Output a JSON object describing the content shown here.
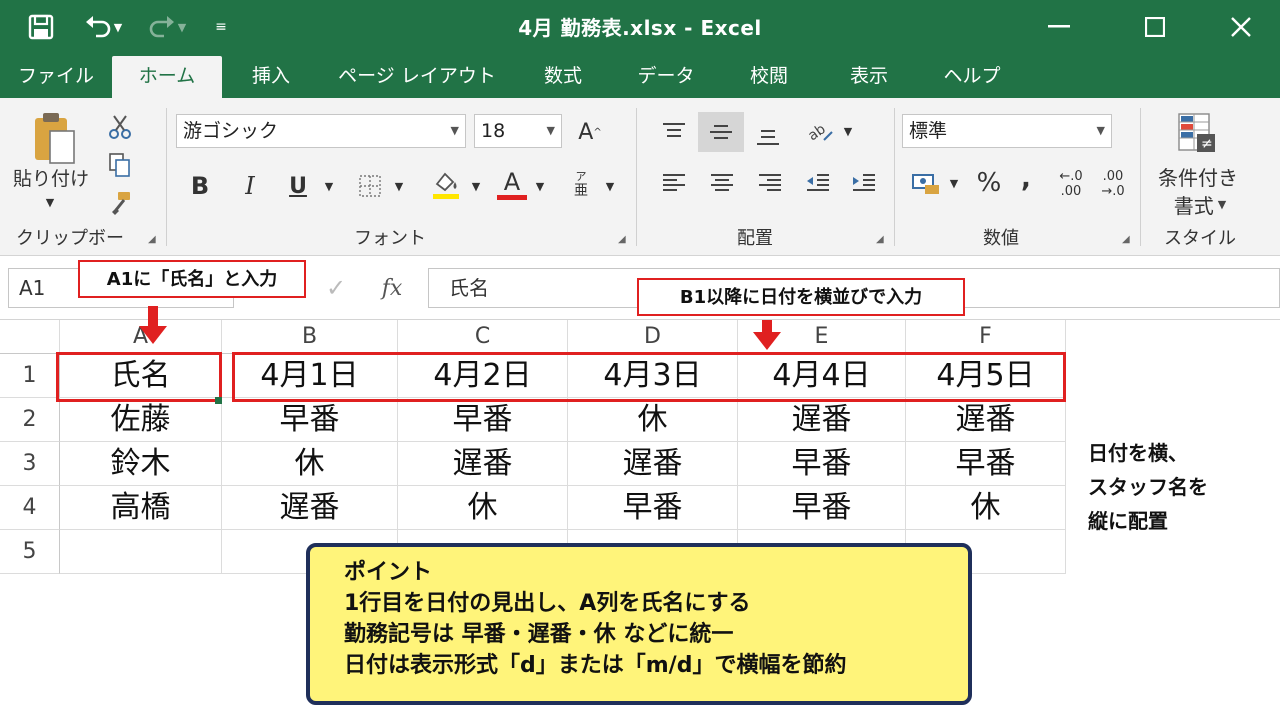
{
  "window": {
    "title": "4月 勤務表.xlsx  -  Excel"
  },
  "tabs": [
    "ファイル",
    "ホーム",
    "挿入",
    "ページ レイアウト",
    "数式",
    "データ",
    "校閲",
    "表示",
    "ヘルプ"
  ],
  "ribbon": {
    "clipboard": {
      "paste_label": "貼り付け",
      "group_label": "クリップボード"
    },
    "font": {
      "font_name": "游ゴシック",
      "font_size": "18",
      "bold": "B",
      "italic": "I",
      "underline": "U",
      "font_color": "A",
      "group_label": "フォント"
    },
    "alignment": {
      "group_label": "配置"
    },
    "number": {
      "format": "標準",
      "percent": "%",
      "comma": ",",
      "inc_decimal_top": "←.0",
      "inc_decimal_bottom": ".00",
      "dec_decimal_top": ".00",
      "dec_decimal_bottom": "→.0",
      "group_label": "数値"
    },
    "styles": {
      "conditional_line1": "条件付き",
      "conditional_line2": "書式",
      "group_label": "スタイル"
    }
  },
  "formula_bar": {
    "name_box": "A1",
    "fx": "fx",
    "content": "氏名"
  },
  "sheet": {
    "columns": [
      "A",
      "B",
      "C",
      "D",
      "E",
      "F"
    ],
    "rows": [
      "1",
      "2",
      "3",
      "4",
      "5"
    ],
    "cells": [
      [
        "氏名",
        "4月1日",
        "4月2日",
        "4月3日",
        "4月4日",
        "4月5日"
      ],
      [
        "佐藤",
        "早番",
        "早番",
        "休",
        "遅番",
        "遅番"
      ],
      [
        "鈴木",
        "休",
        "遅番",
        "遅番",
        "早番",
        "早番"
      ],
      [
        "高橋",
        "遅番",
        "休",
        "早番",
        "早番",
        "休"
      ],
      [
        "",
        "",
        "",
        "",
        "",
        ""
      ]
    ]
  },
  "annotations": {
    "callout_a1": "A1に「氏名」と入力",
    "callout_b1": "B1以降に日付を横並びで入力",
    "side_note": [
      "日付を横、",
      "スタッフ名を",
      "縦に配置"
    ],
    "point": {
      "title": "ポイント",
      "lines": [
        "1行目を日付の見出し、A列を氏名にする",
        "勤務記号は 早番・遅番・休 などに統一",
        "日付は表示形式「d」または「m/d」で横幅を節約"
      ]
    }
  },
  "colors": {
    "excel_green": "#217346",
    "annotation_red": "#e02020",
    "point_box_bg": "#fff47a",
    "point_box_border": "#1f2f5a"
  }
}
